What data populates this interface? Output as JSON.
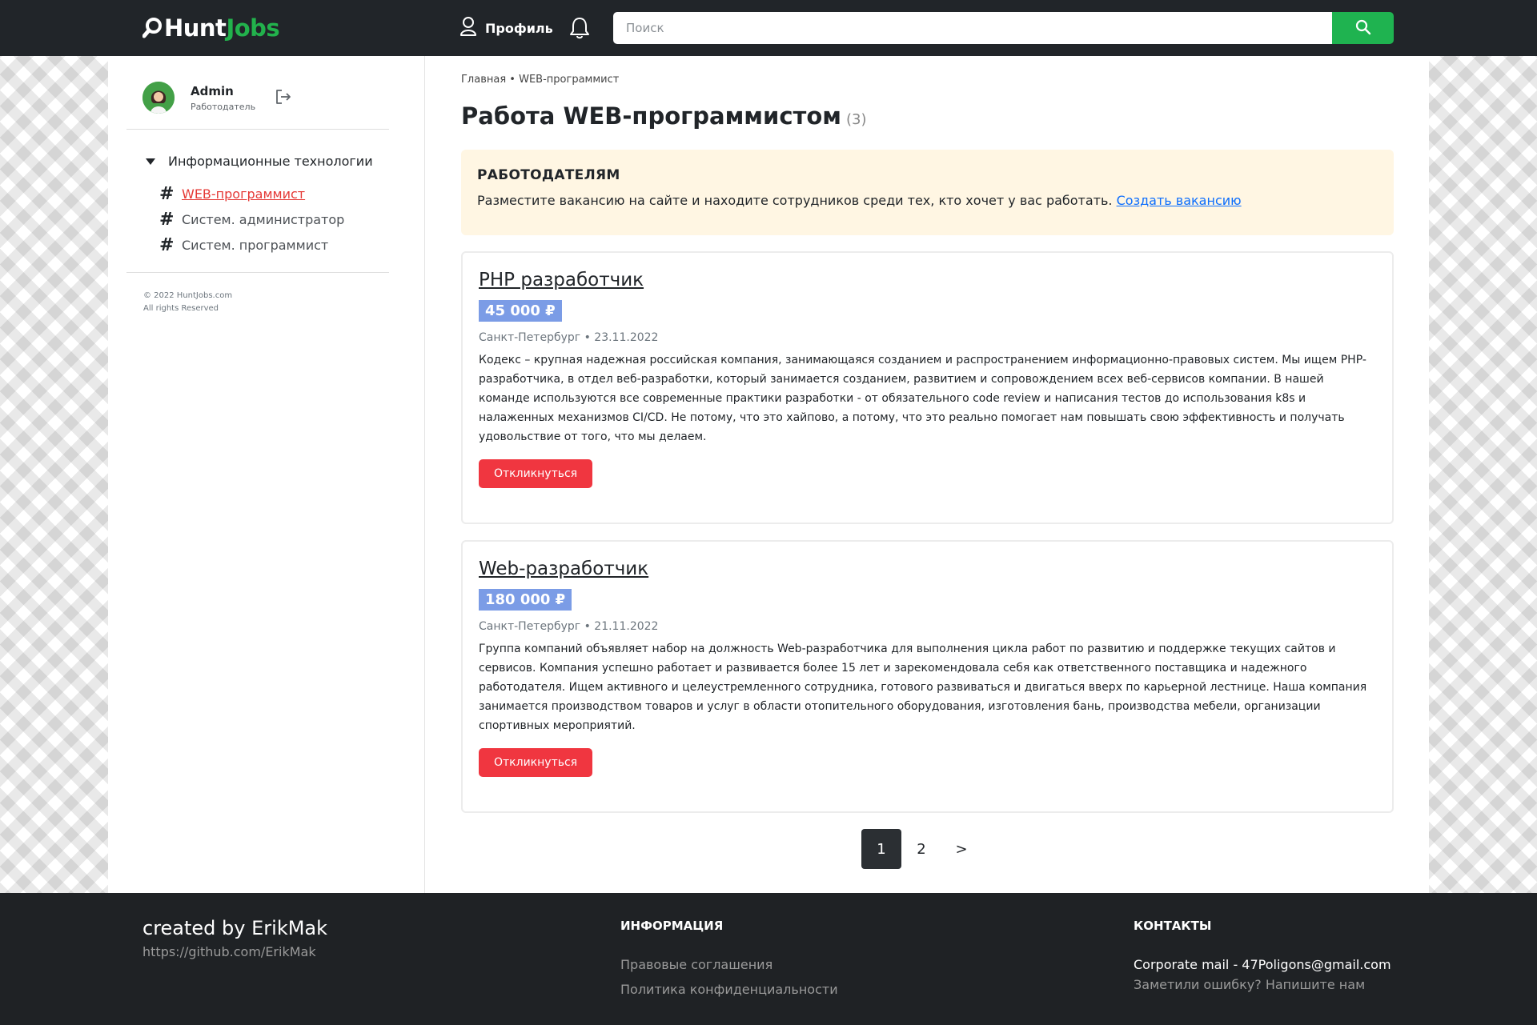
{
  "header": {
    "logo_part_a": "Hunt",
    "logo_part_b": "Jobs",
    "profile_label": "Профиль",
    "search_placeholder": "Поиск"
  },
  "sidebar": {
    "user_name": "Admin",
    "user_role": "Работодатель",
    "category": "Информационные технологии",
    "items": [
      {
        "label": "WEB-программист",
        "active": true
      },
      {
        "label": "Систем. администратор",
        "active": false
      },
      {
        "label": "Систем. программист",
        "active": false
      }
    ],
    "copyright_line1": "© 2022 HuntJobs.com",
    "copyright_line2": "All rights Reserved"
  },
  "main": {
    "breadcrumb_home": "Главная",
    "breadcrumb_sep": "•",
    "breadcrumb_current": "WEB-программист",
    "title": "Работа WEB-программистом",
    "count": "(3)",
    "employer_heading": "РАБОТОДАТЕЛЯМ",
    "employer_text": "Разместите вакансию на сайте и находите сотрудников среди тех, кто хочет у вас работать.",
    "employer_link": "Создать вакансию",
    "vacancies": [
      {
        "title": "PHP разработчик",
        "salary": "45 000 ₽",
        "meta": "Санкт-Петербург • 23.11.2022",
        "description": "Кодекс – крупная надежная российская компания, занимающаяся созданием и распространением информационно-правовых систем. Мы ищем PHP-разработчика, в отдел веб-разработки, который занимается созданием, развитием и сопровождением всех веб-сервисов компании. В нашей команде используются все современные практики разработки - от обязательного code review и написания тестов до использования k8s и налаженных механизмов CI/CD. Не потому, что это хайпово, а потому, что это реально помогает нам повышать свою эффективность и получать удовольствие от того, что мы делаем.",
        "button": "Откликнуться"
      },
      {
        "title": "Web-разработчик",
        "salary": "180 000 ₽",
        "meta": "Санкт-Петербург • 21.11.2022",
        "description": "Группа компаний объявляет набор на должность Web-разработчика для выполнения цикла работ по развитию и поддержке текущих сайтов и сервисов. Компания успешно работает и развивается более 15 лет и зарекомендовала себя как ответственного поставщика и надежного работодателя. Ищем активного и целеустремленного сотрудника, готового развиваться и двигаться вверх по карьерной лестнице. Наша компания занимается производством товаров и услуг в области отопительного оборудования, изготовления бань, производства мебели, организации спортивных мероприятий.",
        "button": "Откликнуться"
      }
    ],
    "pagination": [
      "1",
      "2",
      ">"
    ],
    "current_page": "1"
  },
  "footer": {
    "author": "created by ErikMak",
    "github": "https://github.com/ErikMak",
    "info_heading": "ИНФОРМАЦИЯ",
    "info_links": [
      "Правовые соглашения",
      "Политика конфиденциальности"
    ],
    "contacts_heading": "КОНТАКТЫ",
    "contacts_mail": "Corporate mail - 47Poligons@gmail.com",
    "contacts_report": "Заметили ошибку? Напишите нам"
  },
  "colors": {
    "brand_green": "#22b24c",
    "header_bg": "#212529",
    "accent_red": "#f03640",
    "salary_bg": "#7b9ce6",
    "notice_bg": "#fff6e3"
  },
  "icons": [
    "search-icon",
    "user-icon",
    "bell-icon",
    "logout-icon",
    "caret-down-icon",
    "hash-icon"
  ]
}
